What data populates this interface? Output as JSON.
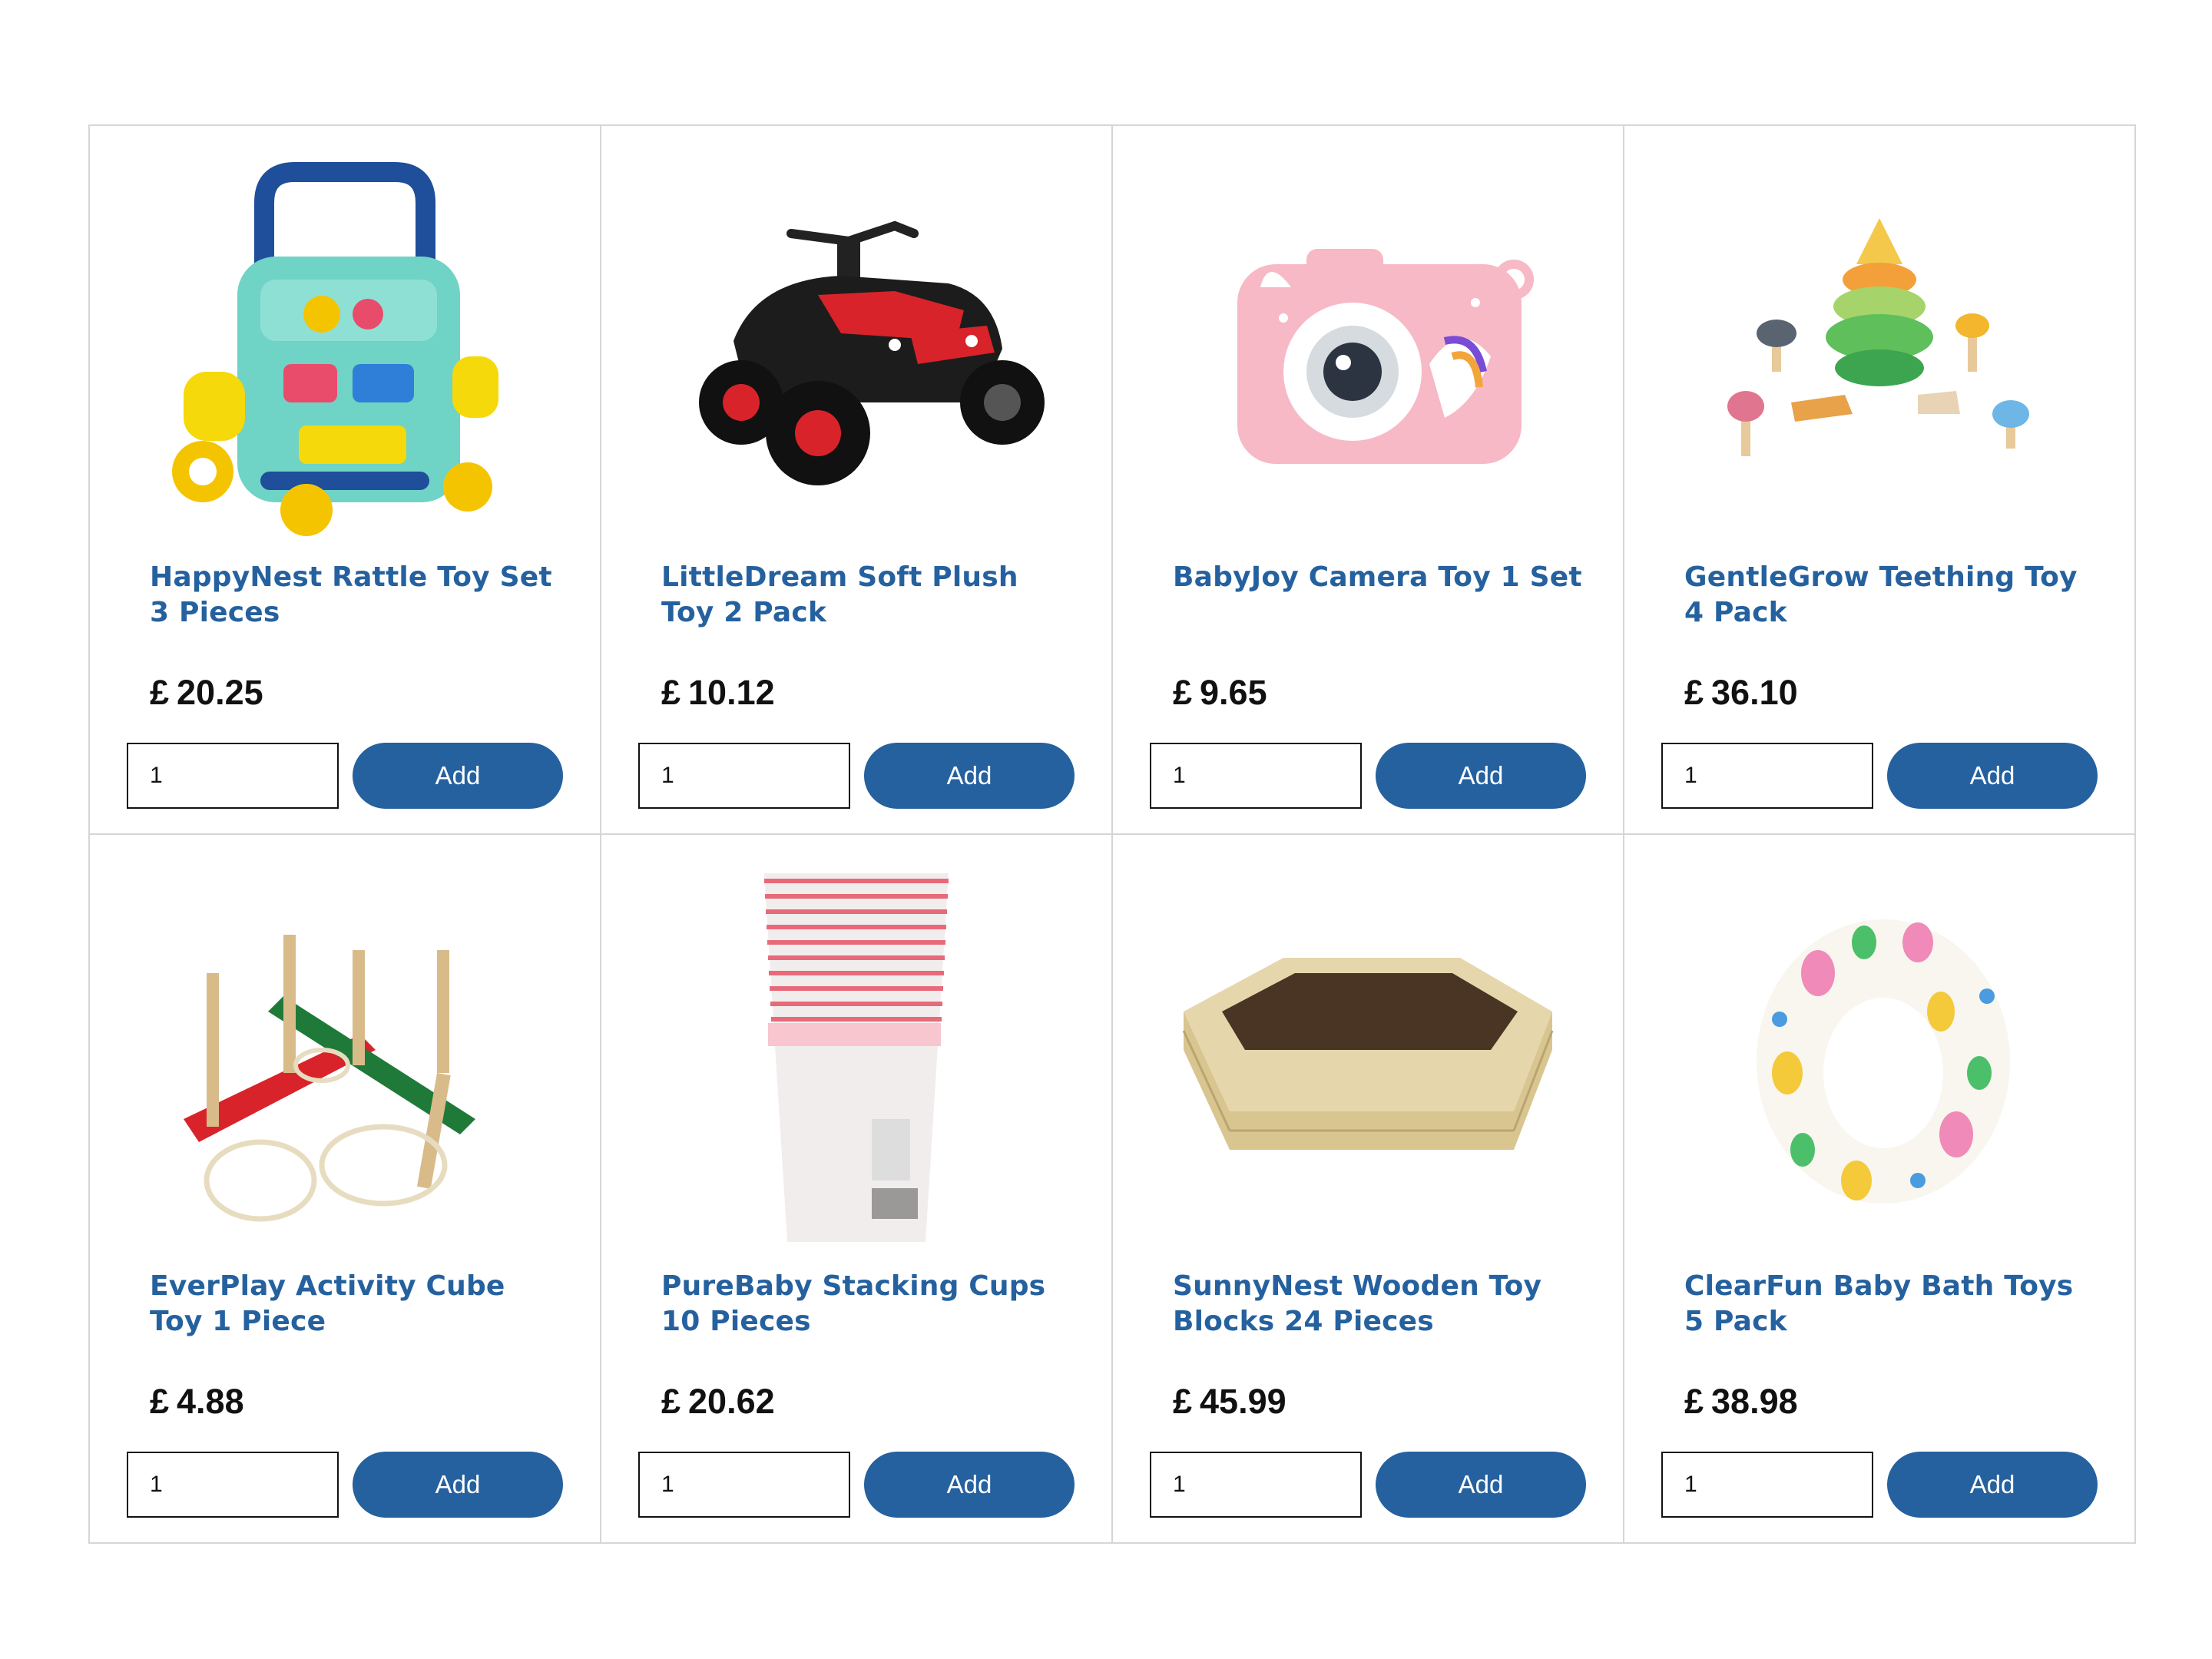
{
  "currency_symbol": "£",
  "add_label": "Add",
  "products": [
    {
      "name": "HappyNest Rattle Toy Set 3 Pieces",
      "price": "20.25",
      "qty": "1",
      "image": "baby-walker-toy-image"
    },
    {
      "name": "LittleDream Soft Plush Toy 2 Pack",
      "price": "10.12",
      "qty": "1",
      "image": "ride-on-quad-bike-image"
    },
    {
      "name": "BabyJoy Camera Toy 1 Set",
      "price": "9.65",
      "qty": "1",
      "image": "unicorn-camera-toy-image"
    },
    {
      "name": "GentleGrow Teething Toy 4 Pack",
      "price": "36.10",
      "qty": "1",
      "image": "wooden-forest-toy-set-image"
    },
    {
      "name": "EverPlay Activity Cube Toy 1 Piece",
      "price": "4.88",
      "qty": "1",
      "image": "ring-toss-game-image"
    },
    {
      "name": "PureBaby Stacking Cups 10 Pieces",
      "price": "20.62",
      "qty": "1",
      "image": "paper-cups-stack-image"
    },
    {
      "name": "SunnyNest Wooden Toy Blocks 24 Pieces",
      "price": "45.99",
      "qty": "1",
      "image": "wooden-sandpit-image"
    },
    {
      "name": "ClearFun Baby Bath Toys 5 Pack",
      "price": "38.98",
      "qty": "1",
      "image": "inflatable-swim-ring-image"
    }
  ],
  "colors": {
    "accent": "#25619f",
    "border": "#d6d6d6",
    "text": "#111111"
  }
}
